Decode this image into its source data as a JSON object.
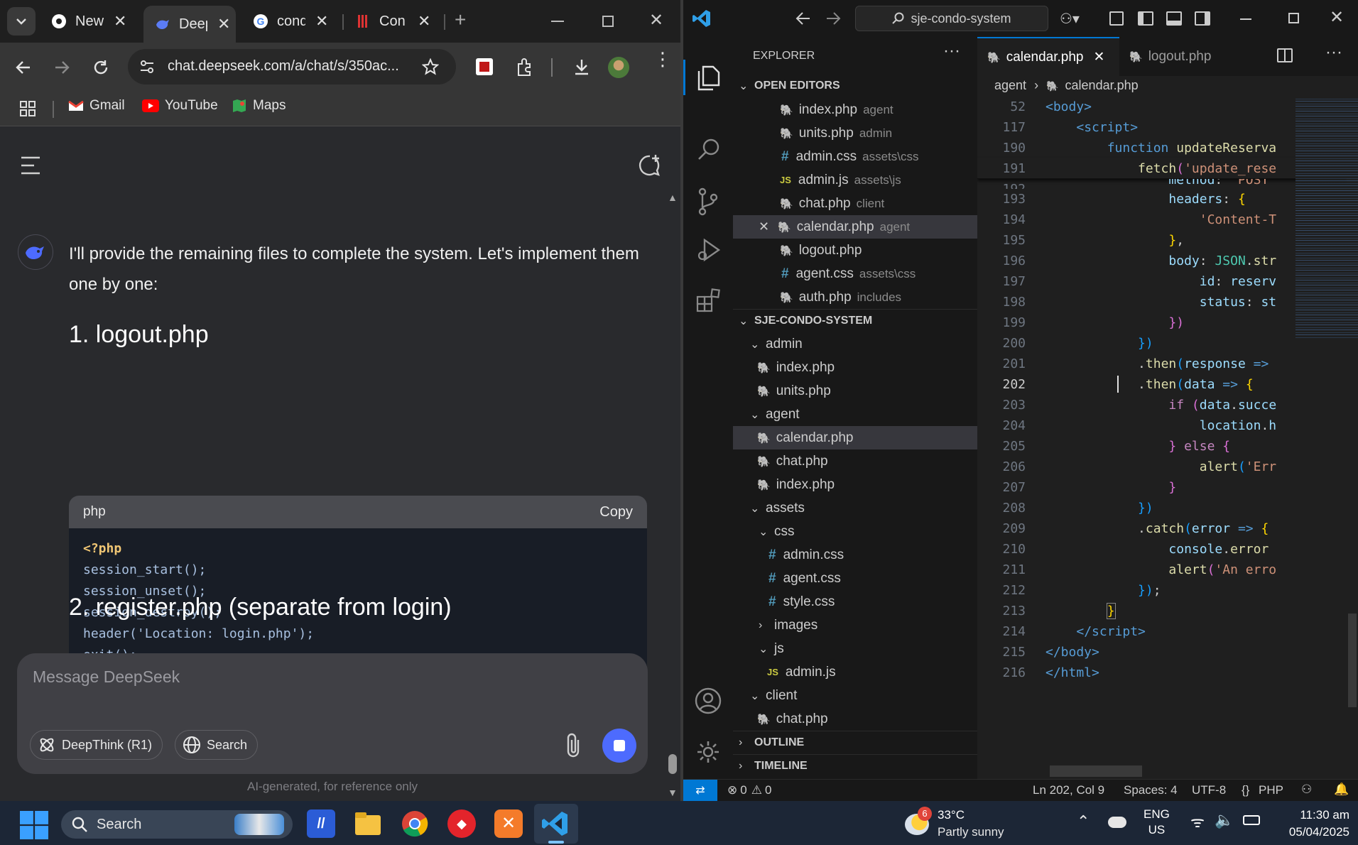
{
  "browser": {
    "tabs": [
      {
        "title": "New",
        "favicon": "chrome-icon"
      },
      {
        "title": "Deep",
        "favicon": "deepseek-icon",
        "active": true
      },
      {
        "title": "cond",
        "favicon": "google-icon"
      },
      {
        "title": "Con",
        "favicon": "condo-icon"
      }
    ],
    "url": "chat.deepseek.com/a/chat/s/350ac...",
    "bookmarks": [
      {
        "label": "Gmail",
        "icon": "gmail-icon"
      },
      {
        "label": "YouTube",
        "icon": "youtube-icon"
      },
      {
        "label": "Maps",
        "icon": "maps-icon"
      }
    ]
  },
  "chat": {
    "message": "I'll provide the remaining files to complete the system. Let's implement them one by one:",
    "heading1": "1. logout.php",
    "code_lang": "php",
    "copy_label": "Copy",
    "code_lines": [
      "<?php",
      "session_start();",
      "session_unset();",
      "session_destroy();",
      "header('Location: login.php');",
      "exit();",
      "?>"
    ],
    "heading2": "2. register.php (separate from login)",
    "input_placeholder": "Message DeepSeek",
    "deepthink_label": "DeepThink (R1)",
    "search_label": "Search",
    "footer_note": "AI-generated, for reference only"
  },
  "vscode": {
    "search_title": "sje-condo-system",
    "explorer_title": "EXPLORER",
    "open_editors_title": "OPEN EDITORS",
    "open_editors": [
      {
        "name": "index.php",
        "desc": "agent",
        "type": "php"
      },
      {
        "name": "units.php",
        "desc": "admin",
        "type": "php"
      },
      {
        "name": "admin.css",
        "desc": "assets\\css",
        "type": "css"
      },
      {
        "name": "admin.js",
        "desc": "assets\\js",
        "type": "js"
      },
      {
        "name": "chat.php",
        "desc": "client",
        "type": "php"
      },
      {
        "name": "calendar.php",
        "desc": "agent",
        "type": "php",
        "active": true
      },
      {
        "name": "logout.php",
        "desc": "",
        "type": "php"
      },
      {
        "name": "agent.css",
        "desc": "assets\\css",
        "type": "css"
      },
      {
        "name": "auth.php",
        "desc": "includes",
        "type": "php"
      }
    ],
    "project_title": "SJE-CONDO-SYSTEM",
    "tree": [
      {
        "name": "admin",
        "kind": "folder",
        "depth": 1
      },
      {
        "name": "index.php",
        "kind": "php",
        "depth": 2
      },
      {
        "name": "units.php",
        "kind": "php",
        "depth": 2
      },
      {
        "name": "agent",
        "kind": "folder",
        "depth": 1
      },
      {
        "name": "calendar.php",
        "kind": "php",
        "depth": 2,
        "active": true
      },
      {
        "name": "chat.php",
        "kind": "php",
        "depth": 2
      },
      {
        "name": "index.php",
        "kind": "php",
        "depth": 2
      },
      {
        "name": "assets",
        "kind": "folder",
        "depth": 1
      },
      {
        "name": "css",
        "kind": "folder",
        "depth": 2
      },
      {
        "name": "admin.css",
        "kind": "css",
        "depth": 3
      },
      {
        "name": "agent.css",
        "kind": "css",
        "depth": 3
      },
      {
        "name": "style.css",
        "kind": "css",
        "depth": 3
      },
      {
        "name": "images",
        "kind": "folder-closed",
        "depth": 2
      },
      {
        "name": "js",
        "kind": "folder",
        "depth": 2
      },
      {
        "name": "admin.js",
        "kind": "js",
        "depth": 3
      },
      {
        "name": "client",
        "kind": "folder",
        "depth": 1
      },
      {
        "name": "chat.php",
        "kind": "php",
        "depth": 2
      }
    ],
    "outline_title": "OUTLINE",
    "timeline_title": "TIMELINE",
    "editor_tabs": [
      {
        "name": "calendar.php",
        "active": true
      },
      {
        "name": "logout.php",
        "active": false
      }
    ],
    "breadcrumb": [
      "agent",
      "calendar.php"
    ],
    "status": {
      "errors": "0",
      "warnings": "0",
      "position": "Ln 202, Col 9",
      "spaces": "Spaces: 4",
      "encoding": "UTF-8",
      "language": "PHP"
    }
  },
  "taskbar": {
    "search_label": "Search",
    "weather_temp": "33°C",
    "weather_desc": "Partly sunny",
    "weather_badge": "6",
    "lang_top": "ENG",
    "lang_bottom": "US",
    "time": "11:30 am",
    "date": "05/04/2025"
  }
}
